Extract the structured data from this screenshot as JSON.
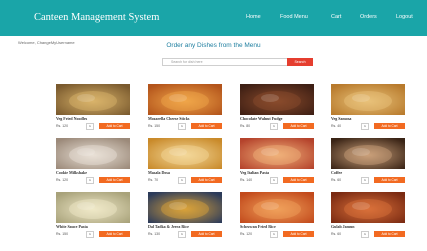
{
  "navbar": {
    "brand": "Canteen Management System",
    "links": [
      "Home",
      "Food Menu",
      "Cart",
      "Orders",
      "Logout"
    ]
  },
  "welcome_text": "Welcome, ChangeMyUsername",
  "heading": "Order any Dishes from the Menu",
  "search": {
    "placeholder": "Search for dish here",
    "button_label": "Search"
  },
  "add_label": "Add to Cart",
  "items": [
    {
      "name": "Veg Fried Noodles",
      "price": "Rs. 120",
      "qty": "1",
      "colors": [
        "#7a5a2e",
        "#d9b36a"
      ]
    },
    {
      "name": "Mozarella Cheese Sticks",
      "price": "Rs. 150",
      "qty": "1",
      "colors": [
        "#b3541b",
        "#f0a64a"
      ]
    },
    {
      "name": "Chocolate Walnut Fudge",
      "price": "Rs. 80",
      "qty": "1",
      "colors": [
        "#3e1f14",
        "#8a4b2c"
      ]
    },
    {
      "name": "Veg Samosa",
      "price": "Rs. 40",
      "qty": "1",
      "colors": [
        "#b87a2c",
        "#e8c27a"
      ]
    },
    {
      "name": "Cookie Milkshake",
      "price": "Rs. 120",
      "qty": "1",
      "colors": [
        "#9c8a7a",
        "#e9e1d6"
      ]
    },
    {
      "name": "Masala Dosa",
      "price": "Rs. 70",
      "qty": "1",
      "colors": [
        "#c98a2a",
        "#f3d89a"
      ]
    },
    {
      "name": "Veg Italian Pasta",
      "price": "Rs. 140",
      "qty": "1",
      "colors": [
        "#b5432c",
        "#f0b17a"
      ]
    },
    {
      "name": "Coffee",
      "price": "Rs. 60",
      "qty": "1",
      "colors": [
        "#3a2416",
        "#caa07a"
      ]
    },
    {
      "name": "White Sauce Pasta",
      "price": "Rs. 150",
      "qty": "1",
      "colors": [
        "#a8a27a",
        "#efe8c8"
      ]
    },
    {
      "name": "Dal Tadka & Jeera Rice",
      "price": "Rs. 130",
      "qty": "1",
      "colors": [
        "#2c3b5a",
        "#d9a23a"
      ]
    },
    {
      "name": "Schezwan Fried Rice",
      "price": "Rs. 120",
      "qty": "1",
      "colors": [
        "#c24a1c",
        "#f0a05a"
      ]
    },
    {
      "name": "Gulab Jamun",
      "price": "Rs. 60",
      "qty": "1",
      "colors": [
        "#7a2a12",
        "#d9703a"
      ]
    }
  ]
}
